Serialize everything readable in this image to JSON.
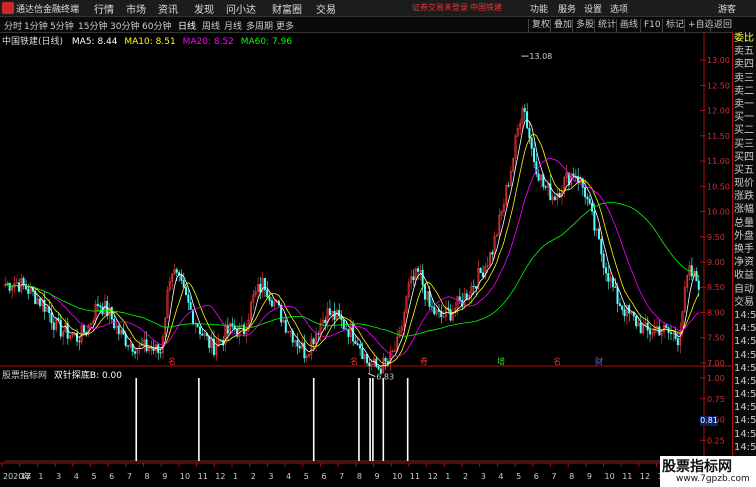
{
  "app": {
    "name": "通达信金融终端",
    "menus": [
      "行情",
      "市场",
      "资讯",
      "发现",
      "问小达",
      "财富圈",
      "交易"
    ],
    "notice": "证券交易未登录",
    "stock_link": "中国铁建",
    "right": [
      "功能",
      "服务",
      "设置",
      "选项",
      "游客"
    ]
  },
  "periods": [
    "分时",
    "1分钟",
    "5分钟",
    "15分钟",
    "30分钟",
    "60分钟",
    "日线",
    "周线",
    "月线",
    "多周期",
    "更多"
  ],
  "active_period": "日线",
  "toolbar_right": [
    "复权",
    "叠加",
    "多股",
    "统计",
    "画线",
    "F10",
    "标记",
    "+自选",
    "返回"
  ],
  "header": {
    "title": "中国铁建(日线)",
    "ma5": "MA5: 8.44",
    "ma10": "MA10: 8.51",
    "ma20": "MA20: 8.52",
    "ma60": "MA60: 7.96",
    "colors": {
      "ma5": "#ffffff",
      "ma10": "#ffff00",
      "ma20": "#ff00ff",
      "ma60": "#00ff00"
    }
  },
  "sub": {
    "title": "股票指标网",
    "formula": "双针探底B: 0.00",
    "value": "0.81"
  },
  "side": [
    "委比",
    "卖五",
    "卖四",
    "卖三",
    "卖二",
    "卖一",
    "买一",
    "买二",
    "买三",
    "买四",
    "买五",
    "现价",
    "涨跌",
    "涨幅",
    "总量",
    "外盘",
    "换手",
    "净资",
    "收益",
    "自动",
    "交易",
    "14:5",
    "14:5",
    "14:5",
    "14:5",
    "14:5",
    "14:5",
    "14:5",
    "14:5",
    "14:5",
    "14:5",
    "14:5"
  ],
  "watermark": {
    "title": "股票指标网",
    "url": "www.7gpzb.com"
  },
  "chart_data": {
    "type": "candlestick",
    "y_ticks": [
      "13.00",
      "12.50",
      "12.00",
      "11.50",
      "11.00",
      "10.50",
      "10.00",
      "9.50",
      "9.00",
      "8.50",
      "8.00",
      "7.50",
      "7.00"
    ],
    "ylim": [
      6.8,
      13.3
    ],
    "annotations": [
      {
        "label": "13.08",
        "value": 13.08
      },
      {
        "label": "6.83",
        "value": 6.83
      }
    ],
    "markers": [
      {
        "label": "名",
        "color": "#e33"
      },
      {
        "label": "名",
        "color": "#e33"
      },
      {
        "label": "券",
        "color": "#e33"
      },
      {
        "label": "增",
        "color": "#3c3"
      },
      {
        "label": "名",
        "color": "#e33"
      },
      {
        "label": "财",
        "color": "#66f"
      }
    ],
    "x_labels": [
      "2020年",
      "12",
      "1",
      "3",
      "4",
      "5",
      "6",
      "7",
      "8",
      "9",
      "10",
      "11",
      "12",
      "1",
      "2",
      "3",
      "4",
      "5",
      "6",
      "7",
      "8",
      "9",
      "10",
      "11",
      "12",
      "1",
      "2",
      "3",
      "4",
      "5",
      "6",
      "7",
      "8",
      "9",
      "10",
      "11",
      "12",
      "1",
      "2",
      "3"
    ],
    "sub_ticks": [
      "1.00",
      "0.75",
      "0.50",
      "0.25"
    ],
    "close_path": [
      8.55,
      8.6,
      8.5,
      8.3,
      8.1,
      7.7,
      7.6,
      7.5,
      7.7,
      8.2,
      8.0,
      7.6,
      7.4,
      7.3,
      7.3,
      7.2,
      8.9,
      8.5,
      8.0,
      7.6,
      7.3,
      7.5,
      7.7,
      7.6,
      8.3,
      8.6,
      8.2,
      7.8,
      7.5,
      7.2,
      7.6,
      8.0,
      7.9,
      7.7,
      7.5,
      7.0,
      6.9,
      7.0,
      7.4,
      8.5,
      8.8,
      8.1,
      7.9,
      8.0,
      8.2,
      8.5,
      8.8,
      9.2,
      10.0,
      11.0,
      12.2,
      11.1,
      10.5,
      10.3,
      10.6,
      10.8,
      10.4,
      9.6,
      8.9,
      8.3,
      8.0,
      7.8,
      7.6,
      7.7,
      7.6,
      7.5,
      8.8,
      8.6
    ],
    "spikes": [
      0.19,
      0.28,
      0.445,
      0.51,
      0.526,
      0.53,
      0.545,
      0.58
    ],
    "spike_value": 1.0
  }
}
